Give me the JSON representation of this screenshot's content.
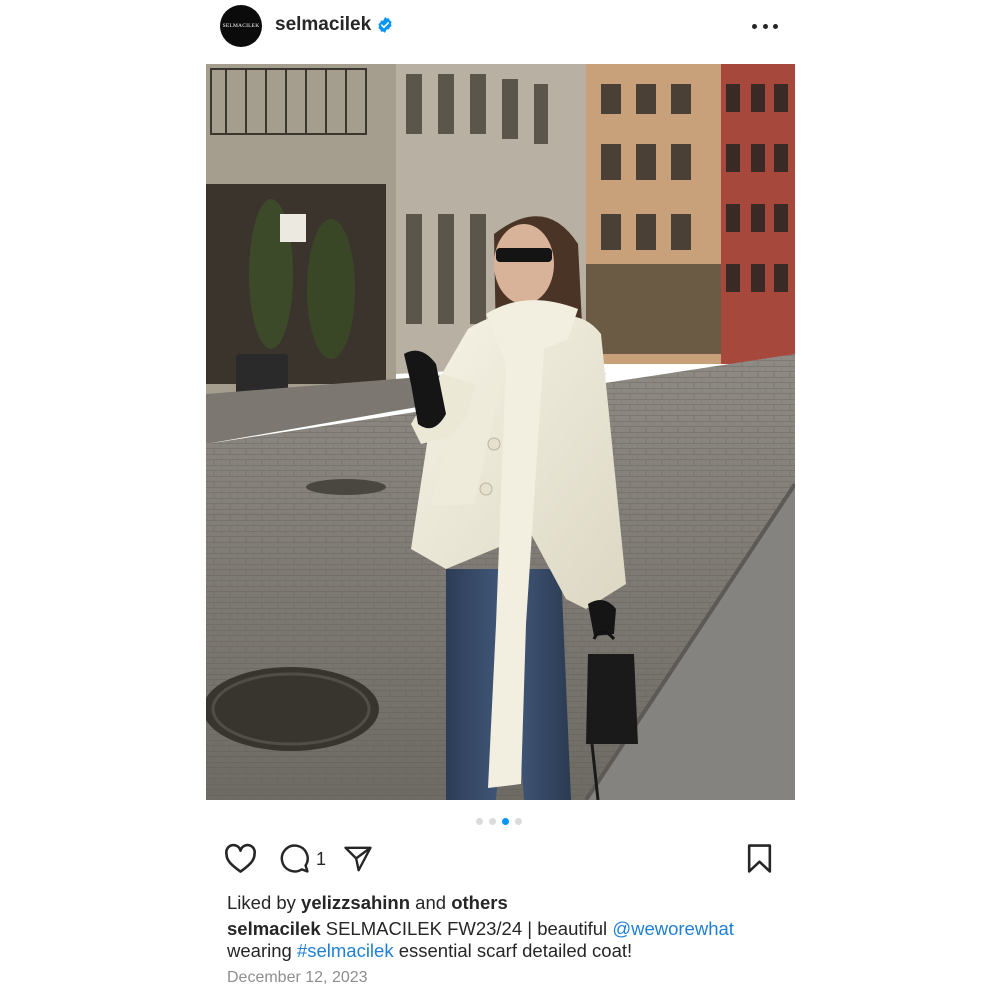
{
  "post": {
    "username": "selmacilek",
    "avatar_text": "SELMACILEK",
    "verified": true,
    "more_icon": "more-horizontal-icon",
    "carousel": {
      "count": 4,
      "active_index": 2
    },
    "actions": {
      "like_icon": "heart-icon",
      "comment_icon": "comment-bubble-icon",
      "comment_count": "1",
      "share_icon": "send-icon",
      "save_icon": "bookmark-icon"
    },
    "likes": {
      "prefix": "Liked by ",
      "user": "yelizzsahinn",
      "middle": " and ",
      "others": "others"
    },
    "caption": {
      "author": "selmacilek",
      "part1": " SELMACILEK FW23/24 | beautiful ",
      "mention": "@weworewhat",
      "part2": " wearing ",
      "hashtag": "#selmacilek",
      "part3": " essential scarf detailed coat!"
    },
    "date": "December 12, 2023"
  },
  "colors": {
    "link": "#1f7fd6",
    "verified": "#0095f6",
    "dot_active": "#0095f6",
    "dot_inactive": "#dbdbdb",
    "text": "#262626",
    "muted": "#8e8e8e"
  }
}
